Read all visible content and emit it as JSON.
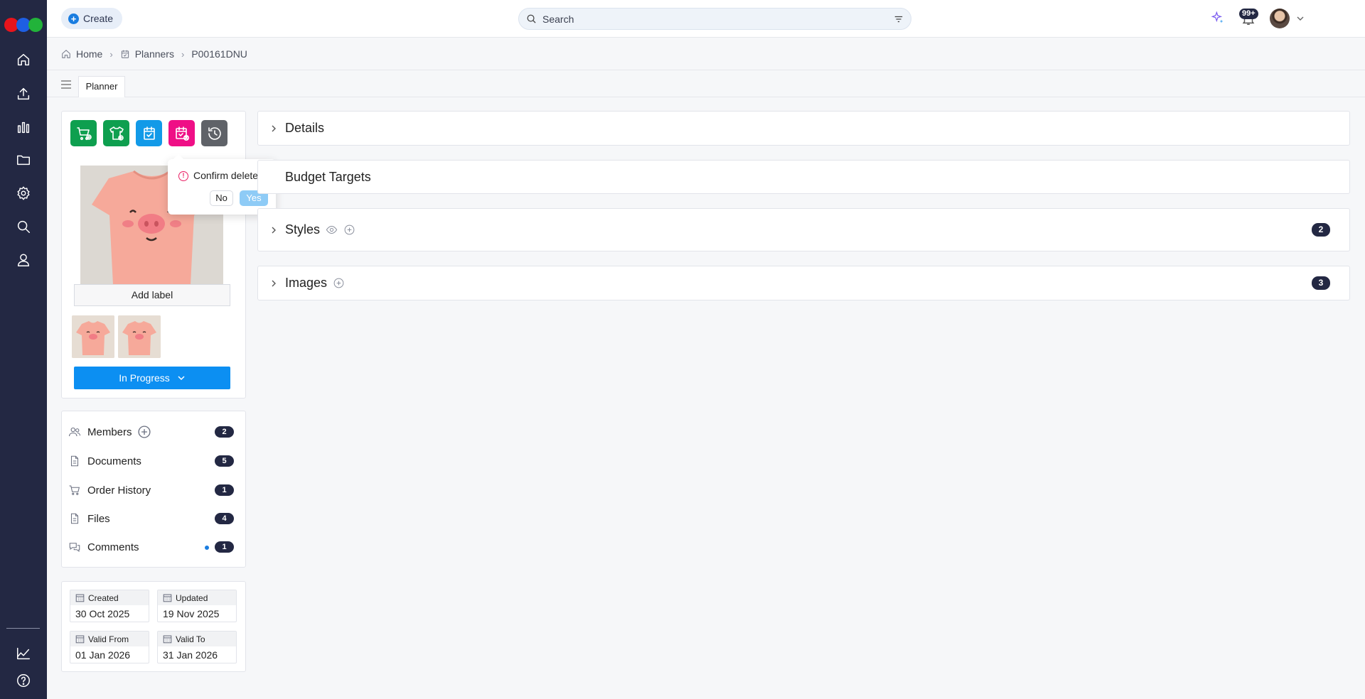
{
  "header": {
    "create_label": "Create",
    "search_placeholder": "Search",
    "notifications_count": "99+"
  },
  "breadcrumb": {
    "items": [
      {
        "label": "Home",
        "icon": "home-icon"
      },
      {
        "label": "Planners",
        "icon": "calendar-check-icon"
      },
      {
        "label": "P00161DNU",
        "icon": ""
      }
    ]
  },
  "tabs": [
    {
      "label": "Planner"
    }
  ],
  "planner_card": {
    "actions": [
      {
        "name": "cart-add",
        "color": "#0e9f4f"
      },
      {
        "name": "garment-add",
        "color": "#0e9f4f"
      },
      {
        "name": "calendar-sync",
        "color": "#129ae8"
      },
      {
        "name": "calendar-delete",
        "color": "#ef0f86"
      },
      {
        "name": "history",
        "color": "#5f6268"
      }
    ],
    "add_label": "Add label",
    "status": "In Progress"
  },
  "popover": {
    "title": "Confirm delete?",
    "no_label": "No",
    "yes_label": "Yes"
  },
  "links": [
    {
      "label": "Members",
      "count": "2"
    },
    {
      "label": "Documents",
      "count": "5"
    },
    {
      "label": "Order History",
      "count": "1"
    },
    {
      "label": "Files",
      "count": "4"
    },
    {
      "label": "Comments",
      "count": "1"
    }
  ],
  "dates": {
    "created": {
      "label": "Created",
      "value": "30 Oct 2025"
    },
    "updated": {
      "label": "Updated",
      "value": "19 Nov 2025"
    },
    "valid_from": {
      "label": "Valid From",
      "value": "01 Jan 2026"
    },
    "valid_to": {
      "label": "Valid To",
      "value": "31 Jan 2026"
    }
  },
  "sections": [
    {
      "title": "Details"
    },
    {
      "title": "Budget Targets"
    },
    {
      "title": "Styles",
      "count": "2"
    },
    {
      "title": "Images",
      "count": "3"
    }
  ],
  "colors": {
    "sidebar": "#232843",
    "primary": "#0c8ff2",
    "badge": "#232843"
  }
}
